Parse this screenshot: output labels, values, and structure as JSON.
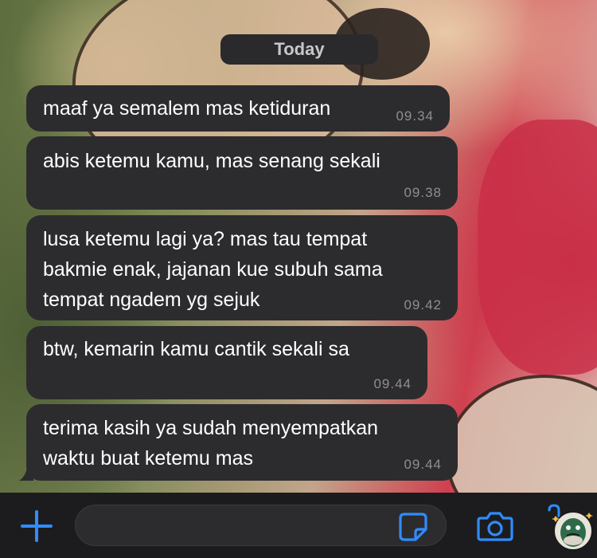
{
  "chat": {
    "date_separator": "Today",
    "messages": [
      {
        "text": "maaf ya semalem mas ketiduran",
        "time": "09.34"
      },
      {
        "text": "abis ketemu kamu, mas senang sekali",
        "time": "09.38"
      },
      {
        "text": "lusa ketemu lagi ya? mas tau tempat\nbakmie enak, jajanan kue subuh sama\ntempat ngadem yg sejuk",
        "time": "09.42"
      },
      {
        "text": "btw, kemarin kamu cantik sekali sa",
        "time": "09.44"
      },
      {
        "text": "terima kasih ya sudah menyempatkan\nwaktu buat ketemu mas",
        "time": "09.44"
      }
    ]
  },
  "composer": {
    "input_value": "",
    "icons": [
      "plus-icon",
      "sticker-icon",
      "camera-icon",
      "mic-sticker-icon"
    ],
    "accent_color": "#2f8cff"
  },
  "colors": {
    "bubble": "#2c2c2e",
    "date_pill": "#2a2a2c",
    "bar": "#1c1c1e",
    "time_text": "#8e8e93"
  }
}
